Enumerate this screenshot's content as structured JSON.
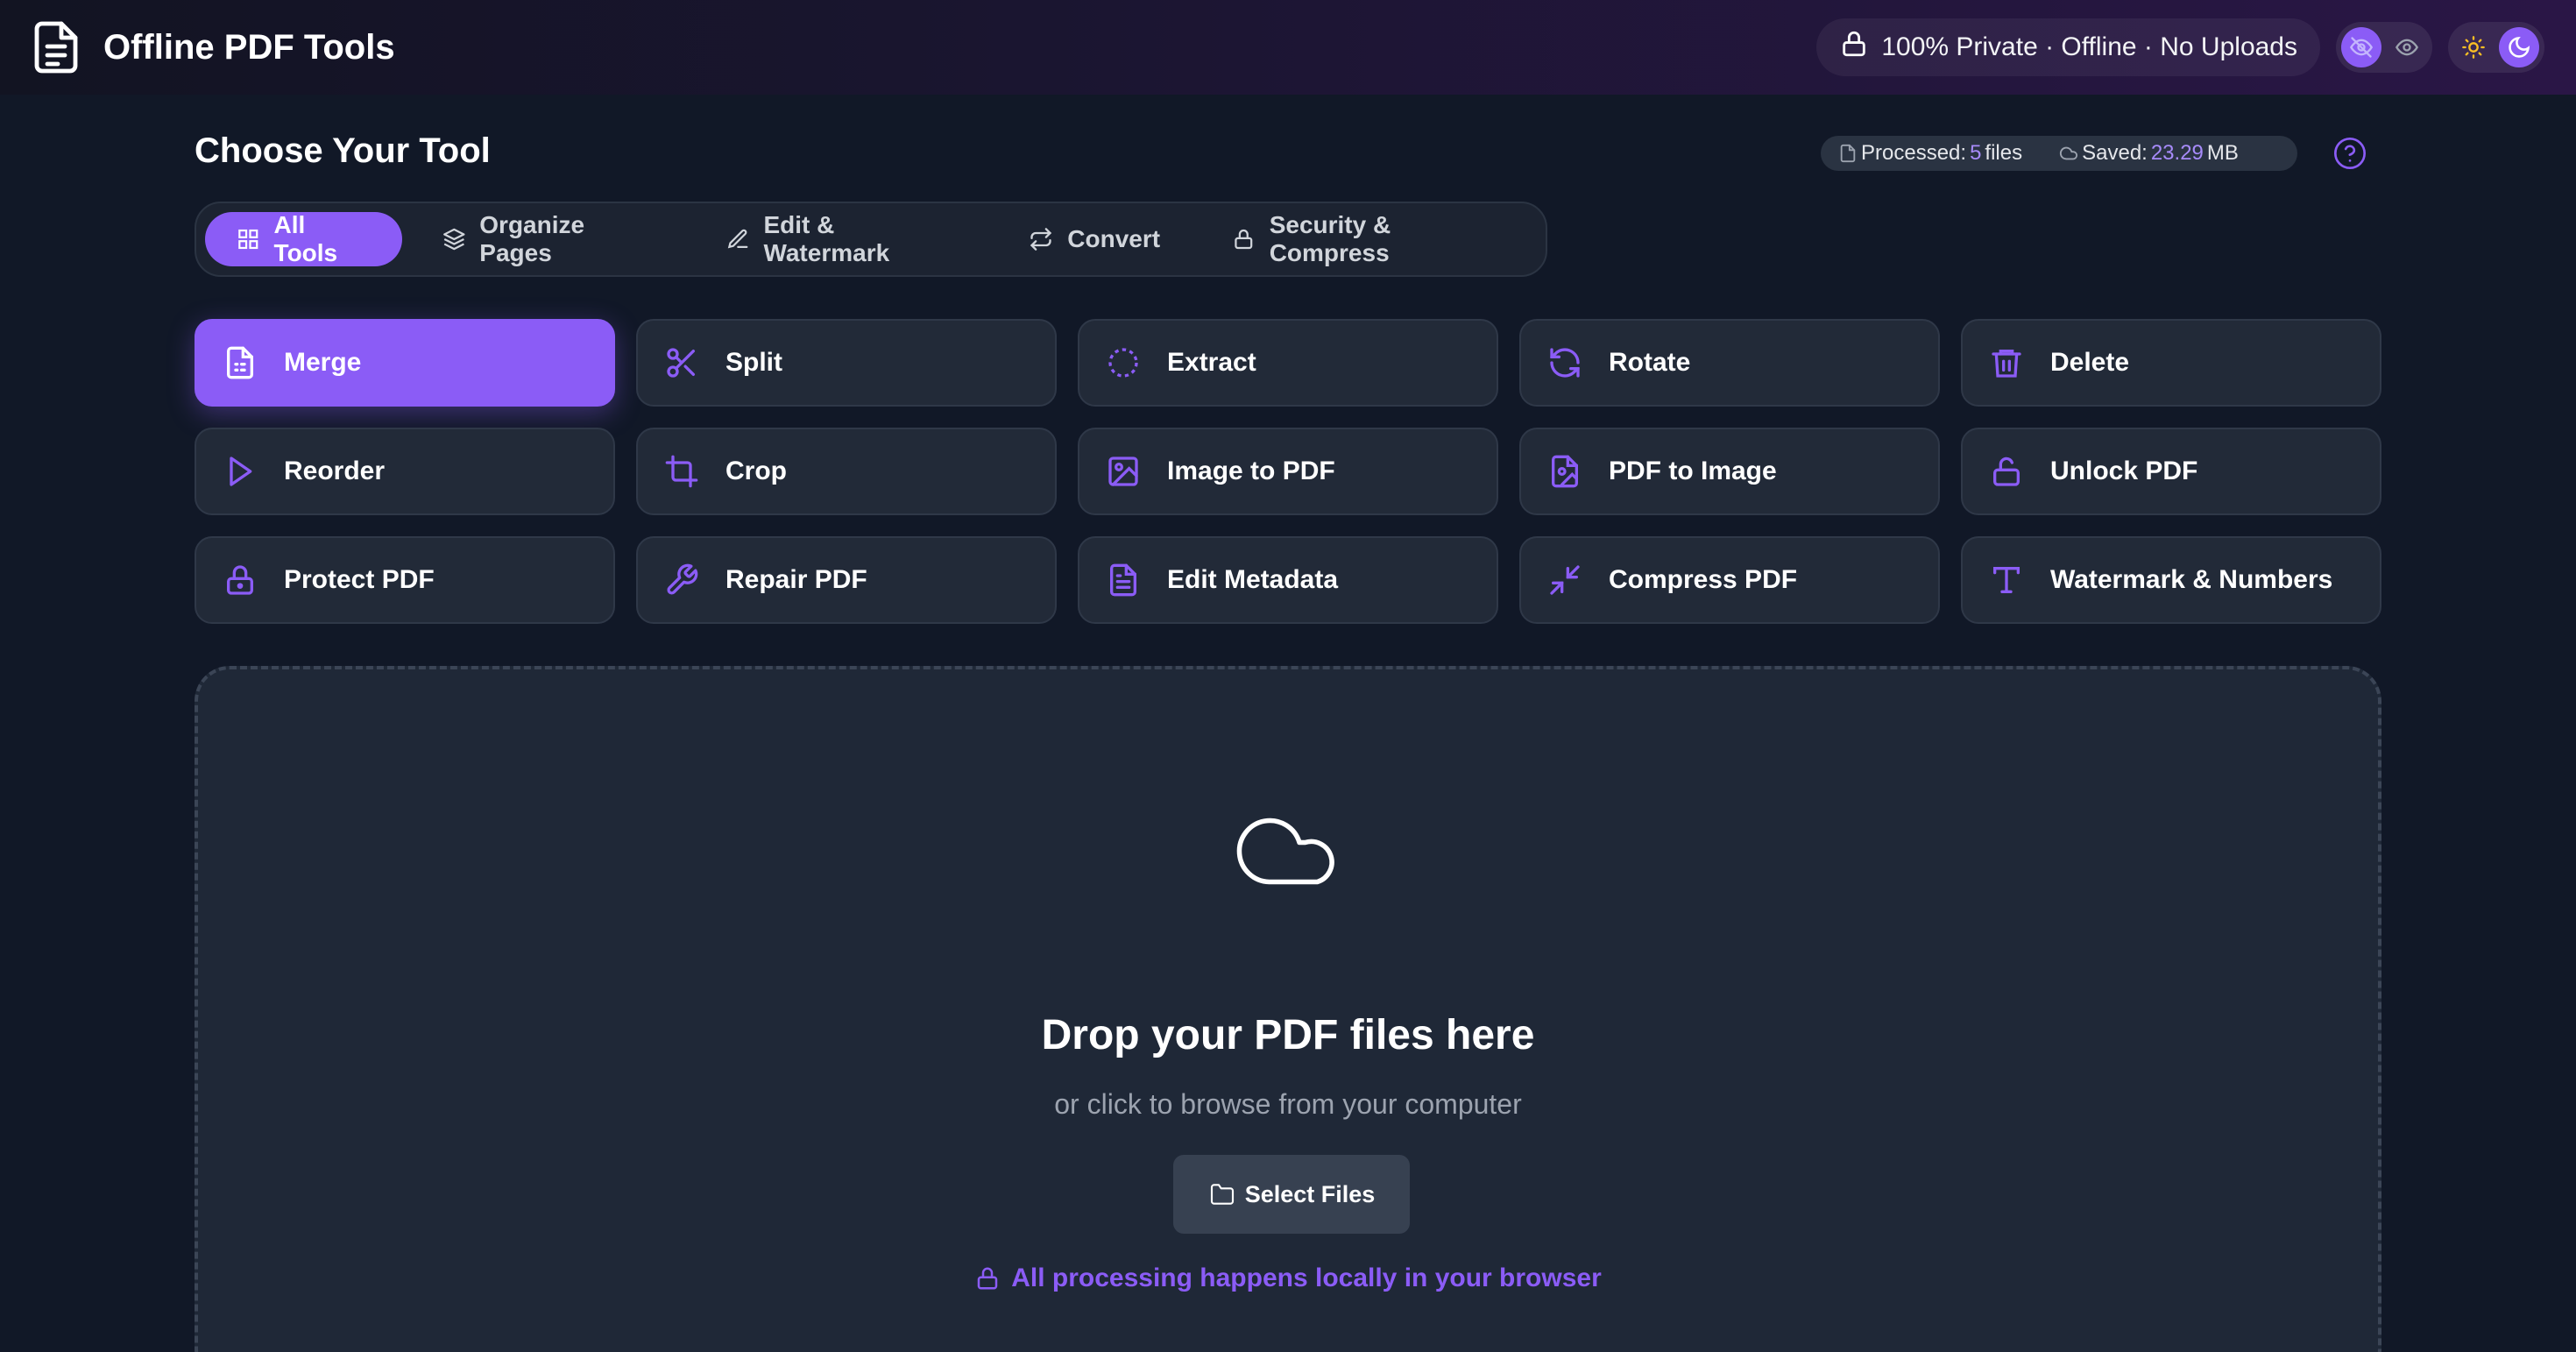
{
  "header": {
    "title": "Offline PDF Tools",
    "privacy_text": "100% Private · Offline · No Uploads"
  },
  "toolbar": {
    "section_title": "Choose Your Tool",
    "stats": {
      "processed_label": "Processed:",
      "processed_count": "5",
      "processed_unit": "files",
      "saved_label": "Saved:",
      "saved_value": "23.29",
      "saved_unit": "MB"
    }
  },
  "tabs": [
    {
      "label": "All Tools",
      "icon": "grid-icon",
      "active": true
    },
    {
      "label": "Organize Pages",
      "icon": "layers-icon",
      "active": false
    },
    {
      "label": "Edit & Watermark",
      "icon": "pen-icon",
      "active": false
    },
    {
      "label": "Convert",
      "icon": "repeat-icon",
      "active": false
    },
    {
      "label": "Security & Compress",
      "icon": "lock-icon",
      "active": false
    }
  ],
  "tools": [
    {
      "label": "Merge",
      "icon": "file-icon",
      "active": true
    },
    {
      "label": "Split",
      "icon": "scissors-icon"
    },
    {
      "label": "Extract",
      "icon": "dashed-circle-icon"
    },
    {
      "label": "Rotate",
      "icon": "rotate-icon"
    },
    {
      "label": "Delete",
      "icon": "trash-icon"
    },
    {
      "label": "Reorder",
      "icon": "play-icon"
    },
    {
      "label": "Crop",
      "icon": "crop-icon"
    },
    {
      "label": "Image to PDF",
      "icon": "image-icon"
    },
    {
      "label": "PDF to Image",
      "icon": "file-image-icon"
    },
    {
      "label": "Unlock PDF",
      "icon": "unlock-icon"
    },
    {
      "label": "Protect PDF",
      "icon": "lock-icon"
    },
    {
      "label": "Repair PDF",
      "icon": "wrench-icon"
    },
    {
      "label": "Edit Metadata",
      "icon": "file-text-icon"
    },
    {
      "label": "Compress PDF",
      "icon": "minimize-icon"
    },
    {
      "label": "Watermark & Numbers",
      "icon": "type-icon"
    }
  ],
  "dropzone": {
    "title": "Drop your PDF files here",
    "subtitle": "or click to browse from your computer",
    "button_label": "Select Files",
    "note": "All processing happens locally in your browser"
  },
  "colors": {
    "accent": "#8b5cf6",
    "background": "#111827",
    "card": "#222a38"
  }
}
